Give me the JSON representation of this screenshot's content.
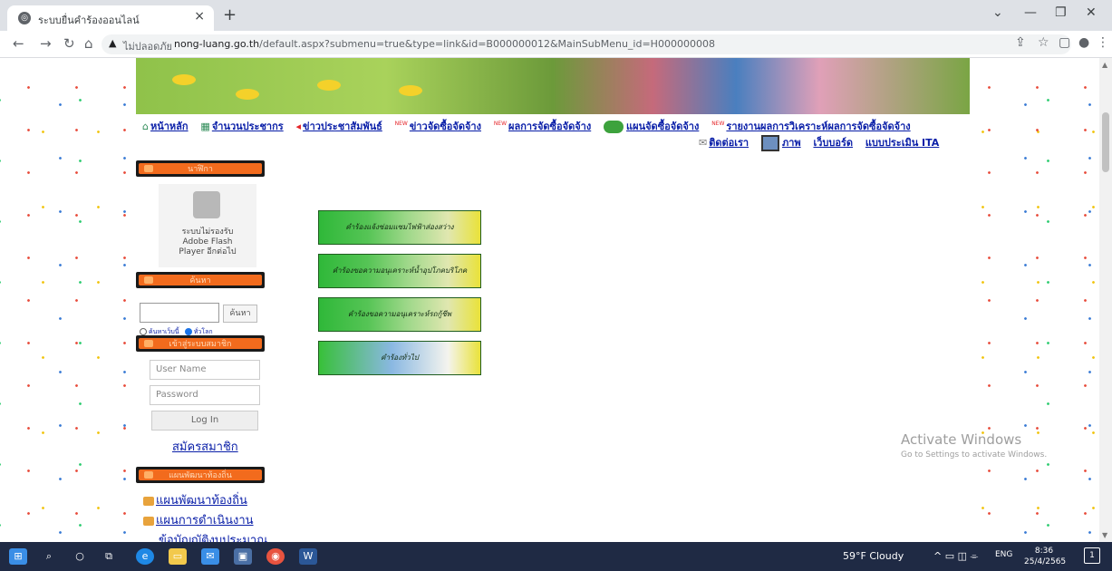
{
  "browser": {
    "tab_title": "ระบบยื่นคำร้องออนไลน์",
    "tab_close": "×",
    "new_tab": "+",
    "insecure_label": "ไม่ปลอดภัย",
    "url_host": "nong-luang.go.th",
    "url_path": "/default.aspx?submenu=true&type=link&id=B000000012&MainSubMenu_id=H000000008"
  },
  "menu": {
    "row1": [
      "หน้าหลัก",
      "จำนวนประชากร",
      "ข่าวประชาสัมพันธ์",
      "ข่าวจัดซื้อจัดจ้าง",
      "ผลการจัดซื้อจัดจ้าง",
      "แผนจัดซื้อจัดจ้าง",
      "รายงานผลการวิเคราะห์ผลการจัดซื้อจัดจ้าง"
    ],
    "row2": [
      "ติดต่อเรา",
      "ภาพ",
      "เว็บบอร์ด",
      "แบบประเมิน ITA"
    ],
    "new_badge": "NEW"
  },
  "sidebar": {
    "clock_header": "นาฬิกา",
    "flash_message": [
      "ระบบไม่รองรับ",
      "Adobe Flash",
      "Player อีกต่อไป"
    ],
    "search_header": "ค้นหา",
    "search_button": "ค้นหา",
    "search_option_site": "ค้นหาเว็บนี้",
    "search_option_web": "ทั่วโลก",
    "member_header": "เข้าสู่ระบบสมาชิก",
    "username_placeholder": "User Name",
    "password_placeholder": "Password",
    "login_button": "Log In",
    "register_link": "สมัครสมาชิก",
    "plan_header": "แผนพัฒนาท้องถิ่น",
    "plan_links": [
      "แผนพัฒนาท้องถิ่น",
      "แผนการดำเนินงาน",
      "ข้อบัญญัติงบประมาณ"
    ]
  },
  "main_buttons": [
    "คำร้องแจ้งซ่อมแซมไฟฟ้าส่องสว่าง",
    "คำร้องขอความอนุเคราะห์น้ำอุปโภคบริโภค",
    "คำร้องขอความอนุเคราะห์รถกู้ชีพ",
    "คำร้องทั่วไป"
  ],
  "watermark": {
    "title": "Activate Windows",
    "subtitle": "Go to Settings to activate Windows."
  },
  "taskbar": {
    "weather": "59°F  Cloudy",
    "lang": "ENG",
    "time": "8:36",
    "date": "25/4/2565",
    "notifications": "1"
  }
}
